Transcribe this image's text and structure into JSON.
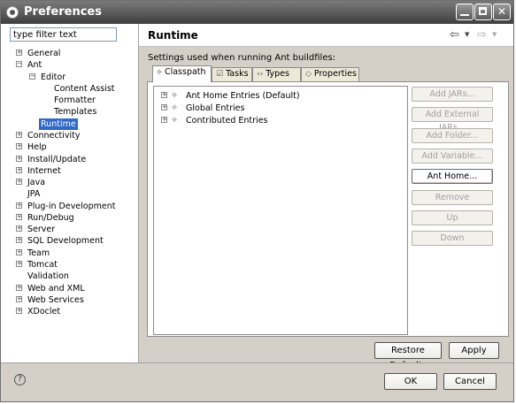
{
  "window": {
    "title": "Preferences"
  },
  "filter": {
    "value": "type filter text"
  },
  "tree": [
    {
      "label": "General",
      "twist": "+",
      "indent": 0
    },
    {
      "label": "Ant",
      "twist": "-",
      "indent": 0
    },
    {
      "label": "Editor",
      "twist": "-",
      "indent": 1
    },
    {
      "label": "Content Assist",
      "twist": "",
      "indent": 2
    },
    {
      "label": "Formatter",
      "twist": "",
      "indent": 2
    },
    {
      "label": "Templates",
      "twist": "",
      "indent": 2
    },
    {
      "label": "Runtime",
      "twist": "",
      "indent": 1,
      "selected": true
    },
    {
      "label": "Connectivity",
      "twist": "+",
      "indent": 0
    },
    {
      "label": "Help",
      "twist": "+",
      "indent": 0
    },
    {
      "label": "Install/Update",
      "twist": "+",
      "indent": 0
    },
    {
      "label": "Internet",
      "twist": "+",
      "indent": 0
    },
    {
      "label": "Java",
      "twist": "+",
      "indent": 0
    },
    {
      "label": "JPA",
      "twist": "",
      "indent": 0
    },
    {
      "label": "Plug-in Development",
      "twist": "+",
      "indent": 0
    },
    {
      "label": "Run/Debug",
      "twist": "+",
      "indent": 0
    },
    {
      "label": "Server",
      "twist": "+",
      "indent": 0
    },
    {
      "label": "SQL Development",
      "twist": "+",
      "indent": 0
    },
    {
      "label": "Team",
      "twist": "+",
      "indent": 0
    },
    {
      "label": "Tomcat",
      "twist": "+",
      "indent": 0
    },
    {
      "label": "Validation",
      "twist": "",
      "indent": 0
    },
    {
      "label": "Web and XML",
      "twist": "+",
      "indent": 0
    },
    {
      "label": "Web Services",
      "twist": "+",
      "indent": 0
    },
    {
      "label": "XDoclet",
      "twist": "+",
      "indent": 0
    }
  ],
  "page": {
    "title": "Runtime",
    "settings_label": "Settings used when running Ant buildfiles:",
    "tabs": [
      {
        "label": "Classpath",
        "icon": "classpath-icon",
        "active": true
      },
      {
        "label": "Tasks",
        "icon": "tasks-icon"
      },
      {
        "label": "Types",
        "icon": "types-icon"
      },
      {
        "label": "Properties",
        "icon": "properties-icon"
      }
    ],
    "classpath_entries": [
      "Ant Home Entries (Default)",
      "Global Entries",
      "Contributed Entries"
    ],
    "side_buttons": [
      {
        "label": "Add JARs...",
        "enabled": false
      },
      {
        "label": "Add External JARs...",
        "enabled": false
      },
      {
        "label": "Add Folder...",
        "enabled": false
      },
      {
        "label": "Add Variable...",
        "enabled": false
      },
      {
        "label": "Ant Home...",
        "enabled": true
      },
      {
        "label": "Remove",
        "enabled": false
      },
      {
        "label": "Up",
        "enabled": false
      },
      {
        "label": "Down",
        "enabled": false
      }
    ],
    "restore_defaults": "Restore Defaults",
    "apply": "Apply"
  },
  "footer": {
    "help": "?",
    "ok": "OK",
    "cancel": "Cancel"
  }
}
